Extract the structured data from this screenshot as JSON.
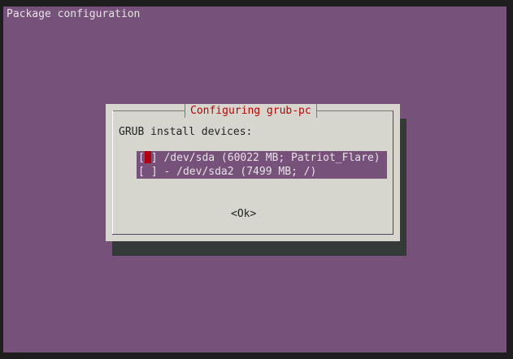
{
  "app": {
    "backtitle": "Package configuration"
  },
  "dialog": {
    "title": "Configuring grub-pc",
    "prompt": "GRUB install devices:",
    "items": [
      {
        "checked": false,
        "focused": true,
        "label": "/dev/sda (60022 MB; Patriot_Flare)"
      },
      {
        "checked": false,
        "focused": false,
        "label": "- /dev/sda2 (7499 MB; /)"
      }
    ],
    "ok_label": "<Ok>"
  },
  "colors": {
    "screen_bg": "#76527a",
    "dialog_bg": "#d6d6cf",
    "title_color": "#c00000",
    "cursor_color": "#b00010",
    "shadow": "#333a37"
  }
}
